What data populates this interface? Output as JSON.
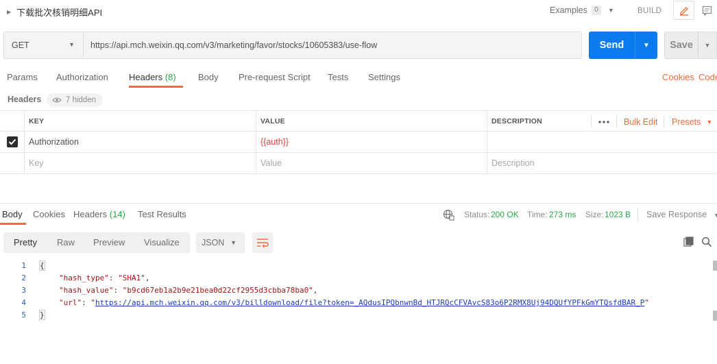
{
  "request": {
    "title": "下载批次核销明细API",
    "examples_label": "Examples",
    "examples_count": "0",
    "build_label": "BUILD",
    "method": "GET",
    "url": "https://api.mch.weixin.qq.com/v3/marketing/favor/stocks/10605383/use-flow",
    "send_label": "Send",
    "save_label": "Save"
  },
  "request_tabs": {
    "params": "Params",
    "authorization": "Authorization",
    "headers": "Headers",
    "headers_count": "(8)",
    "body": "Body",
    "prerequest": "Pre-request Script",
    "tests": "Tests",
    "settings": "Settings",
    "cookies": "Cookies",
    "code": "Code"
  },
  "headers_section": {
    "label": "Headers",
    "hidden_label": "7 hidden"
  },
  "headers_table": {
    "columns": {
      "key": "KEY",
      "value": "VALUE",
      "description": "DESCRIPTION"
    },
    "bulk_edit": "Bulk Edit",
    "presets": "Presets",
    "rows": [
      {
        "checked": true,
        "key": "Authorization",
        "value": "{{auth}}",
        "description": ""
      }
    ],
    "placeholders": {
      "key": "Key",
      "value": "Value",
      "description": "Description"
    }
  },
  "response_tabs": {
    "body": "Body",
    "cookies": "Cookies",
    "headers": "Headers",
    "headers_count": "(14)",
    "test_results": "Test Results"
  },
  "response_status": {
    "status_label": "Status:",
    "status_value": "200 OK",
    "time_label": "Time:",
    "time_value": "273 ms",
    "size_label": "Size:",
    "size_value": "1023 B",
    "save_response": "Save Response"
  },
  "response_toolbar": {
    "pretty": "Pretty",
    "raw": "Raw",
    "preview": "Preview",
    "visualize": "Visualize",
    "language": "JSON"
  },
  "response_body": {
    "line_numbers": [
      "1",
      "2",
      "3",
      "4",
      "5"
    ],
    "open_brace": "{",
    "close_brace": "}",
    "hash_type_key": "\"hash_type\"",
    "hash_type_value": "\"SHA1\"",
    "hash_value_key": "\"hash_value\"",
    "hash_value_value": "\"b9cd67eb1a2b9e21bea0d22cf2955d3cbba78ba0\"",
    "url_key": "\"url\"",
    "url_value": "https://api.mch.weixin.qq.com/v3/billdownload/file?token=_AQdusIPQbnwnBd_HTJRQcCFVAvcS83o6P2RMX8Uj94DQUfYPFkGmYTQsfdBAR_P"
  },
  "colors": {
    "accent": "#f26b3a",
    "send": "#097bed",
    "success": "#27a745",
    "error_text": "#e0403a"
  }
}
